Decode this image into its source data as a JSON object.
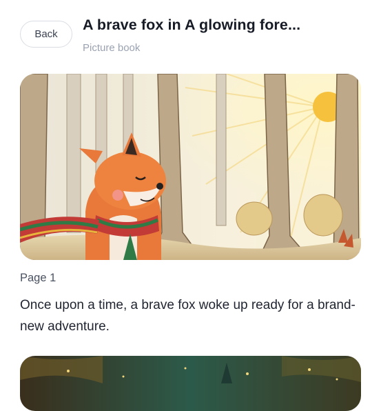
{
  "header": {
    "back_label": "Back",
    "title": "A brave fox in A glowing fore...",
    "subtitle": "Picture book"
  },
  "pages": [
    {
      "label": "Page 1",
      "text": "Once upon a time, a brave fox woke up ready for a brand-new adventure."
    }
  ]
}
